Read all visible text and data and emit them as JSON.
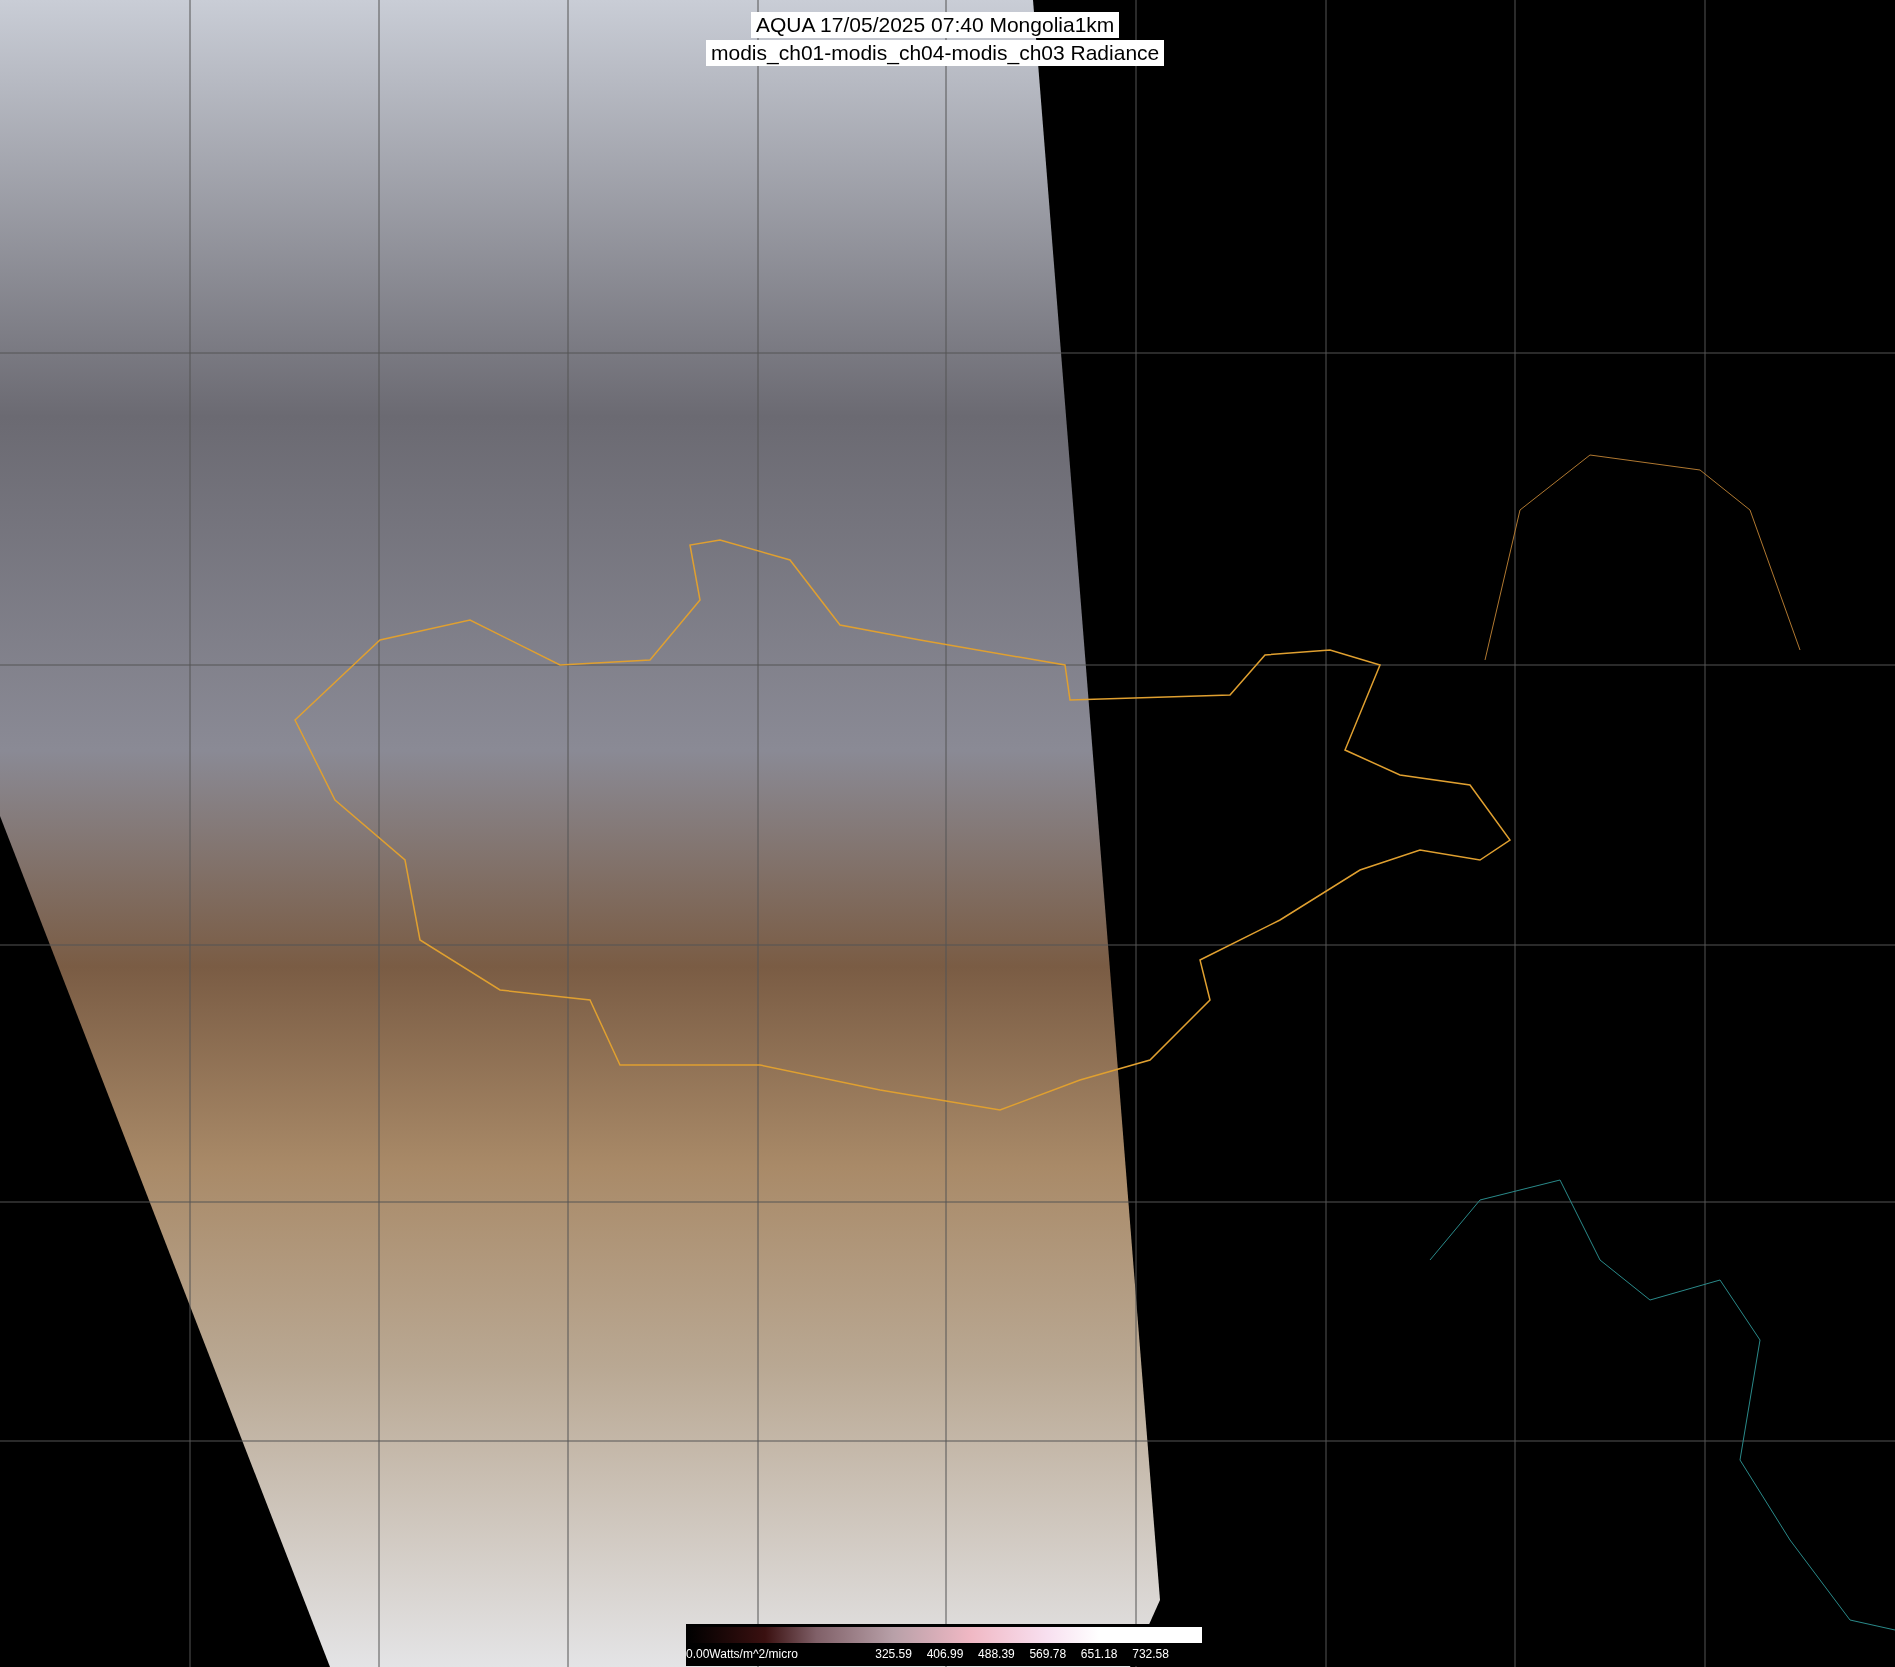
{
  "title": {
    "lines": [
      "AQUA 17/05/2025 07:40 Mongolia1km",
      "modis_ch01-modis_ch04-modis_ch03 Radiance"
    ]
  },
  "colorbar": {
    "unit_label": "0.00Watts/m^2/micro",
    "tick_labels": [
      "325.59",
      "406.99",
      "488.39",
      "569.78",
      "651.18",
      "732.58"
    ]
  }
}
